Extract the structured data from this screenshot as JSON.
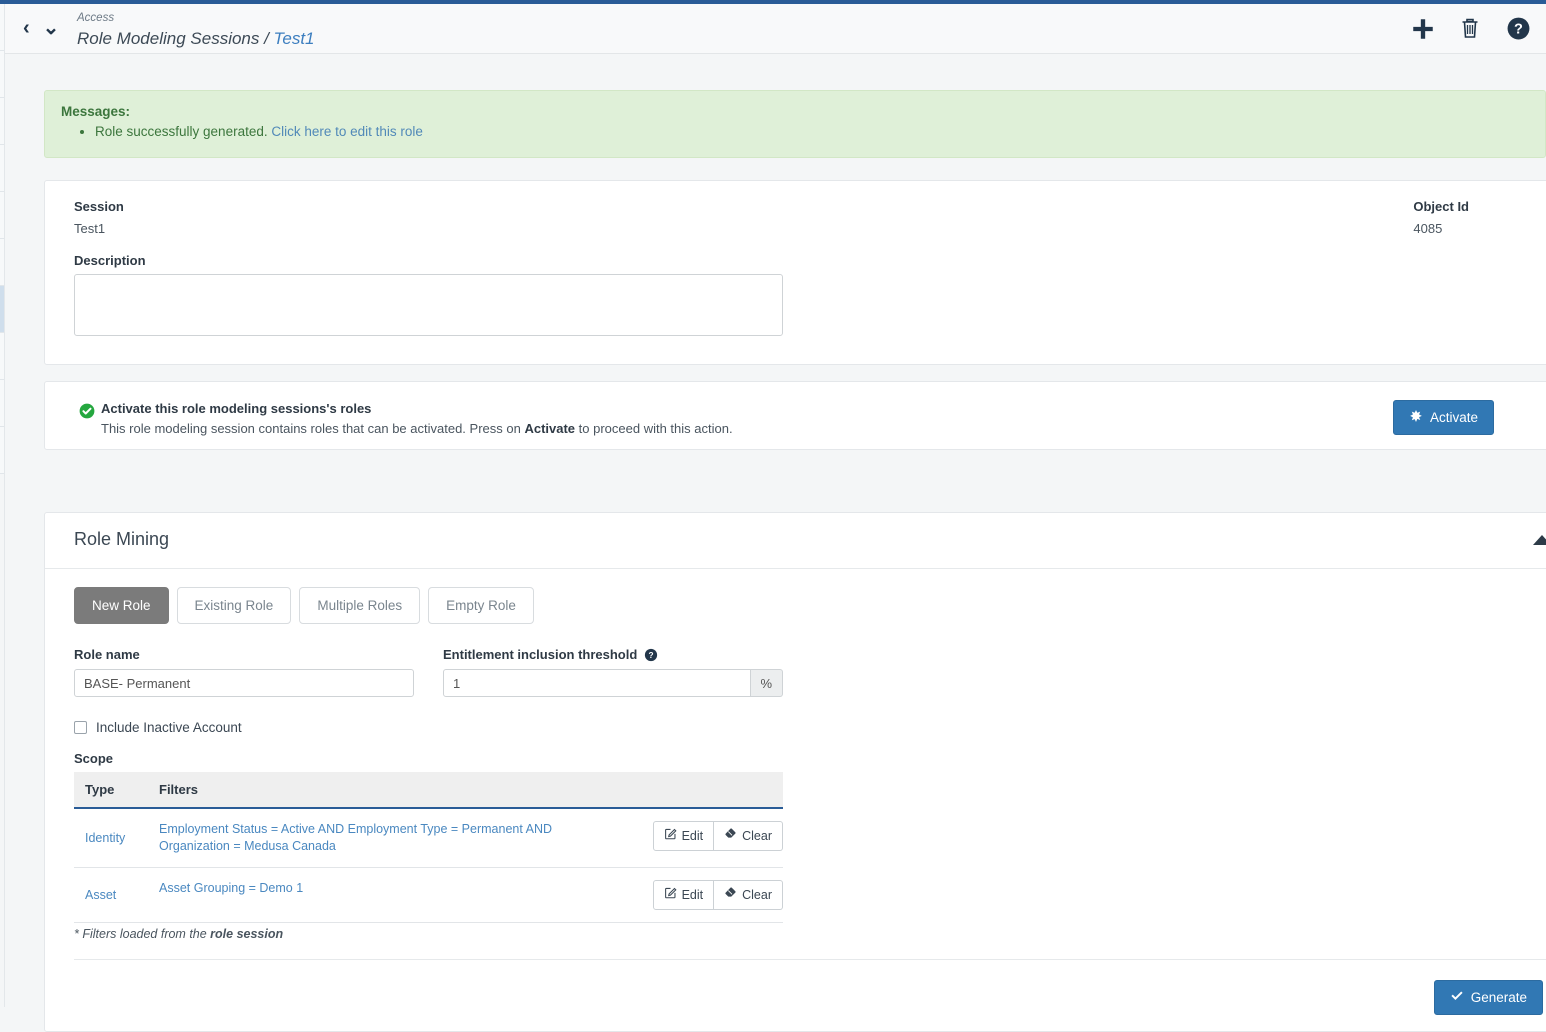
{
  "header": {
    "breadcrumb_parent": "Access",
    "breadcrumb_path": "Role Modeling Sessions / ",
    "breadcrumb_current": "Test1",
    "back_icon": "chevron-left-icon",
    "dropdown_icon": "chevron-down-icon",
    "actions": [
      {
        "name": "add-icon",
        "label": "Add"
      },
      {
        "name": "delete-icon",
        "label": "Delete"
      },
      {
        "name": "help-icon",
        "label": "Help"
      }
    ]
  },
  "messages": {
    "title": "Messages:",
    "items": [
      {
        "text": "Role successfully generated. ",
        "link": "Click here to edit this role"
      }
    ]
  },
  "session": {
    "label": "Session",
    "value": "Test1",
    "object_id_label": "Object Id",
    "object_id_value": "4085",
    "description_label": "Description",
    "description_value": ""
  },
  "activate": {
    "title": "Activate this role modeling sessions's roles",
    "desc_before": "This role modeling session contains roles that can be activated. Press on ",
    "desc_strong": "Activate",
    "desc_after": " to proceed with this action.",
    "button_label": "Activate",
    "button_icon": "asterisk-icon",
    "status_icon": "check-circle-icon"
  },
  "mining": {
    "title": "Role Mining",
    "collapse_icon": "caret-up-icon",
    "tabs": [
      {
        "label": "New Role",
        "active": true
      },
      {
        "label": "Existing Role",
        "active": false
      },
      {
        "label": "Multiple Roles",
        "active": false
      },
      {
        "label": "Empty Role",
        "active": false
      }
    ],
    "role_name_label": "Role name",
    "role_name_value": "BASE- Permanent",
    "threshold_label": "Entitlement inclusion threshold",
    "threshold_help_icon": "help-circle-icon",
    "threshold_value": "1",
    "threshold_addon": "%",
    "include_inactive_label": "Include Inactive Account",
    "include_inactive_checked": false,
    "scope_label": "Scope",
    "scope_columns": [
      "Type",
      "Filters"
    ],
    "scope_rows": [
      {
        "type": "Identity",
        "filters": "Employment Status = Active AND Employment Type = Permanent AND Organization = Medusa Canada",
        "edit_label": "Edit",
        "clear_label": "Clear"
      },
      {
        "type": "Asset",
        "filters": "Asset Grouping = Demo 1",
        "edit_label": "Edit",
        "clear_label": "Clear"
      }
    ],
    "footnote_before": "* Filters loaded from the ",
    "footnote_strong": "role session",
    "generate_label": "Generate",
    "generate_icon": "check-icon"
  },
  "colors": {
    "accent_blue": "#2a5c97",
    "primary_button": "#3178b4",
    "success_bg": "#dff0d8",
    "success_text": "#3c763d",
    "link": "#4a88c0",
    "active_tab": "#7b7b7b"
  }
}
